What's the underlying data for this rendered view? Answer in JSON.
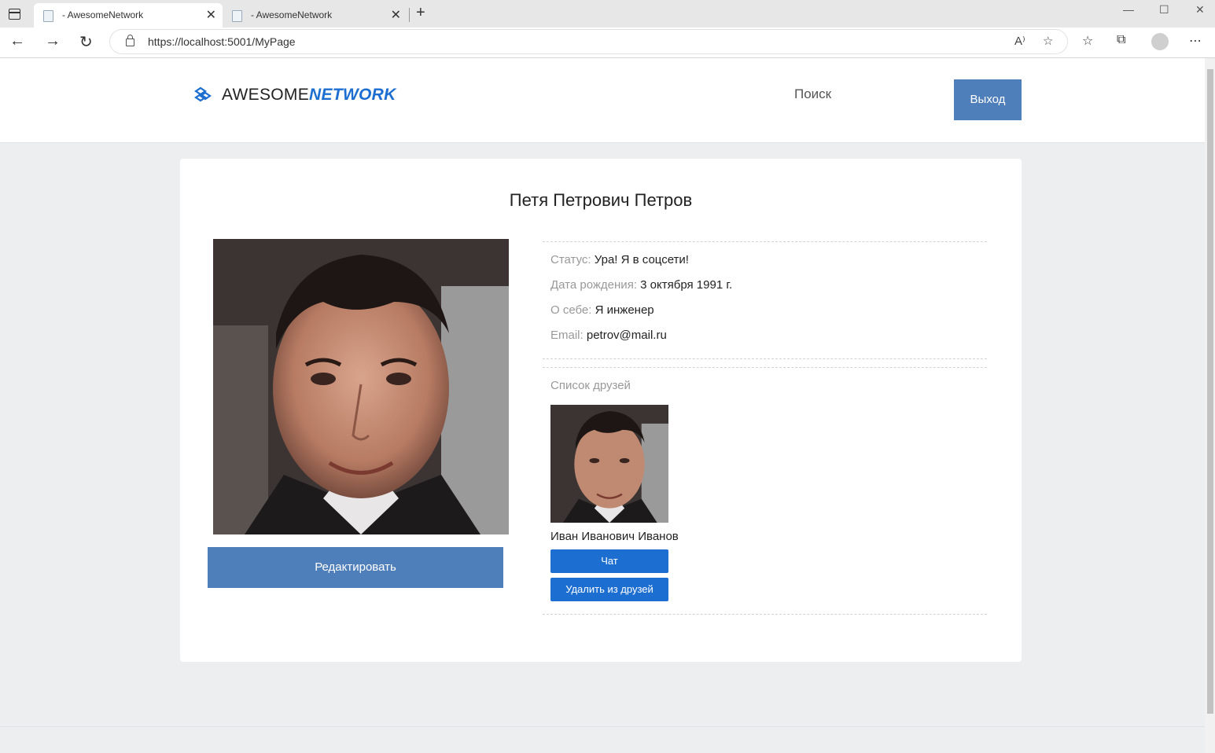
{
  "browser": {
    "tabs": [
      {
        "title": "- AwesomeNetwork",
        "active": true
      },
      {
        "title": "- AwesomeNetwork",
        "active": false
      }
    ],
    "url": "https://localhost:5001/MyPage"
  },
  "header": {
    "logo_part1": "AWESOME",
    "logo_part2": "NETWORK",
    "search_label": "Поиск",
    "logout_label": "Выход"
  },
  "profile": {
    "full_name": "Петя Петрович Петров",
    "edit_label": "Редактировать",
    "fields": [
      {
        "label": "Статус:",
        "value": "Ура! Я в соцсети!"
      },
      {
        "label": "Дата рождения:",
        "value": "3 октября 1991 г."
      },
      {
        "label": "О себе:",
        "value": "Я инженер"
      },
      {
        "label": "Email:",
        "value": "petrov@mail.ru"
      }
    ]
  },
  "friends": {
    "title": "Список друзей",
    "items": [
      {
        "name": "Иван Иванович Иванов",
        "chat_label": "Чат",
        "remove_label": "Удалить из друзей"
      }
    ]
  },
  "colors": {
    "accent": "#4f7fba",
    "brand": "#1c6ed0",
    "page_bg": "#edeef0"
  }
}
